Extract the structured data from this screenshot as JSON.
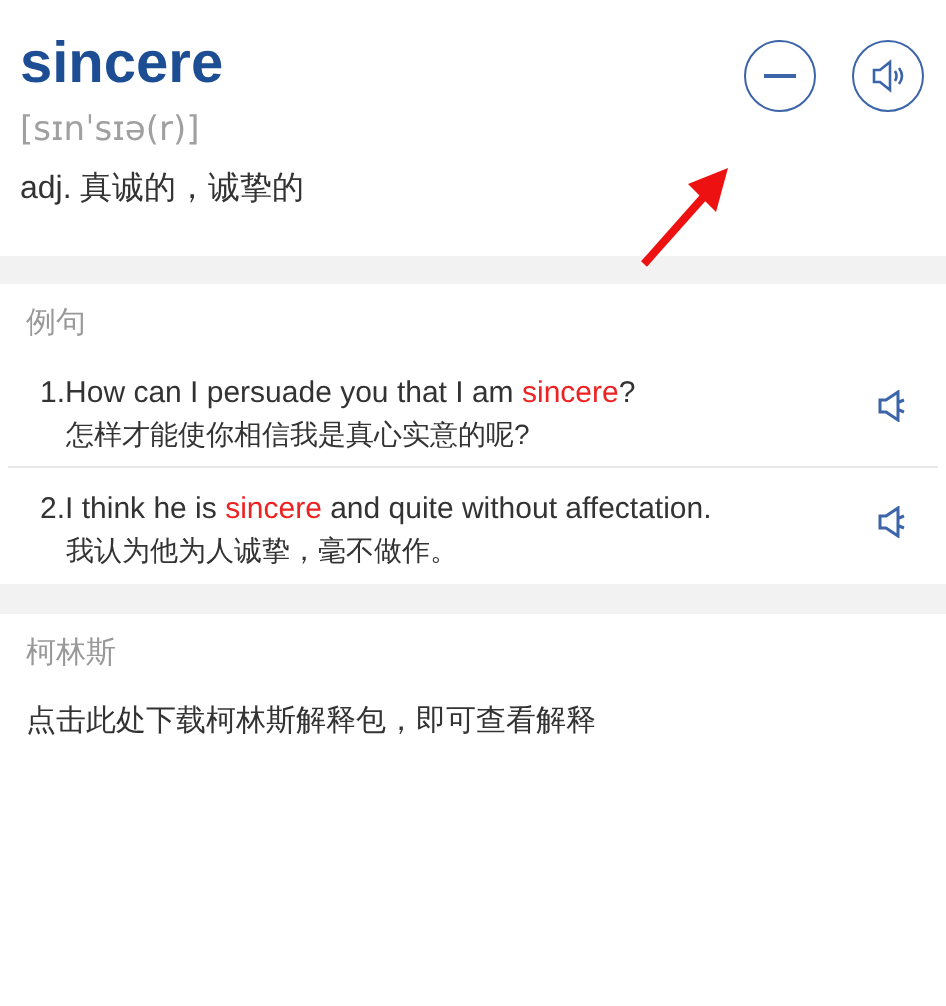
{
  "word": {
    "headword": "sincere",
    "phonetic": "[sɪnˈsɪə(r)]",
    "definition": "adj. 真诚的，诚挚的"
  },
  "examples": {
    "title": "例句",
    "items": [
      {
        "number": "1.",
        "english": [
          {
            "text": "How can I persuade you that I am ",
            "highlight": false
          },
          {
            "text": "sincere",
            "highlight": true
          },
          {
            "text": "?",
            "highlight": false
          }
        ],
        "chinese": "怎样才能使你相信我是真心实意的呢?"
      },
      {
        "number": "2.",
        "english": [
          {
            "text": "I think he is ",
            "highlight": false
          },
          {
            "text": "sincere",
            "highlight": true
          },
          {
            "text": " and quite without affectation.",
            "highlight": false
          }
        ],
        "chinese": "我认为他为人诚挚，毫不做作。"
      }
    ]
  },
  "collins": {
    "title": "柯林斯",
    "link": "点击此处下载柯林斯解释包，即可查看解释"
  }
}
